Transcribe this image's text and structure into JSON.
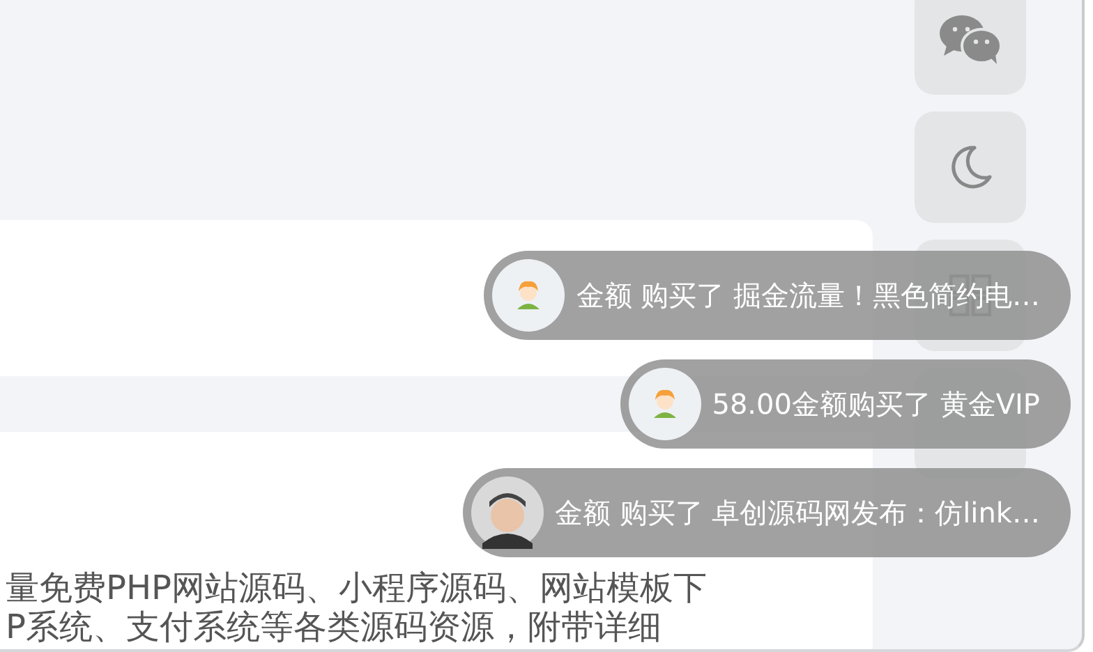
{
  "side_buttons": [
    {
      "kind": "chat"
    },
    {
      "kind": "moon"
    },
    {
      "kind": "grid"
    },
    {
      "kind": "plain"
    }
  ],
  "content_card": {
    "lines": [
      "量免费PHP网站源码、小程序源码、网站模板下",
      "P系统、支付系统等各类源码资源，附带详细"
    ]
  },
  "notifications": [
    {
      "kind": "cartoon",
      "text": "金额 购买了 掘金流量！黑色简约电…"
    },
    {
      "kind": "cartoon",
      "text": "58.00金额购买了 黄金VIP"
    },
    {
      "kind": "photo",
      "text": "金额 购买了 卓创源码网发布：仿link…"
    }
  ]
}
